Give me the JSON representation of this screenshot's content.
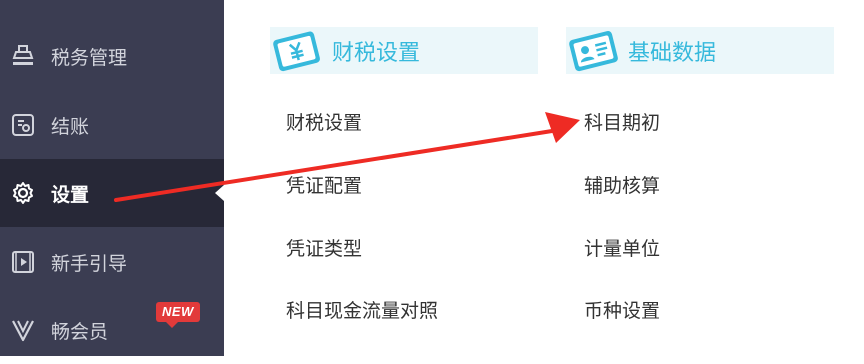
{
  "sidebar": {
    "items": [
      {
        "label": "税务管理",
        "icon": "tax-stamp-icon"
      },
      {
        "label": "结账",
        "icon": "checkout-icon"
      },
      {
        "label": "设置",
        "icon": "gear-icon",
        "active": true
      },
      {
        "label": "新手引导",
        "icon": "video-play-icon"
      },
      {
        "label": "畅会员",
        "icon": "vip-v-icon",
        "badge": "NEW"
      }
    ]
  },
  "sections": [
    {
      "title": "财税设置",
      "icon": "tax-card-icon",
      "links": [
        "财税设置",
        "凭证配置",
        "凭证类型",
        "科目现金流量对照"
      ]
    },
    {
      "title": "基础数据",
      "icon": "id-card-icon",
      "links": [
        "科目期初",
        "辅助核算",
        "计量单位",
        "币种设置"
      ]
    }
  ],
  "colors": {
    "sidebar_bg": "#3b3d52",
    "sidebar_active_bg": "#272837",
    "accent": "#36b9dc",
    "header_bg": "#ebf7fa",
    "arrow": "#ee2b24",
    "badge": "#e23a3a"
  }
}
